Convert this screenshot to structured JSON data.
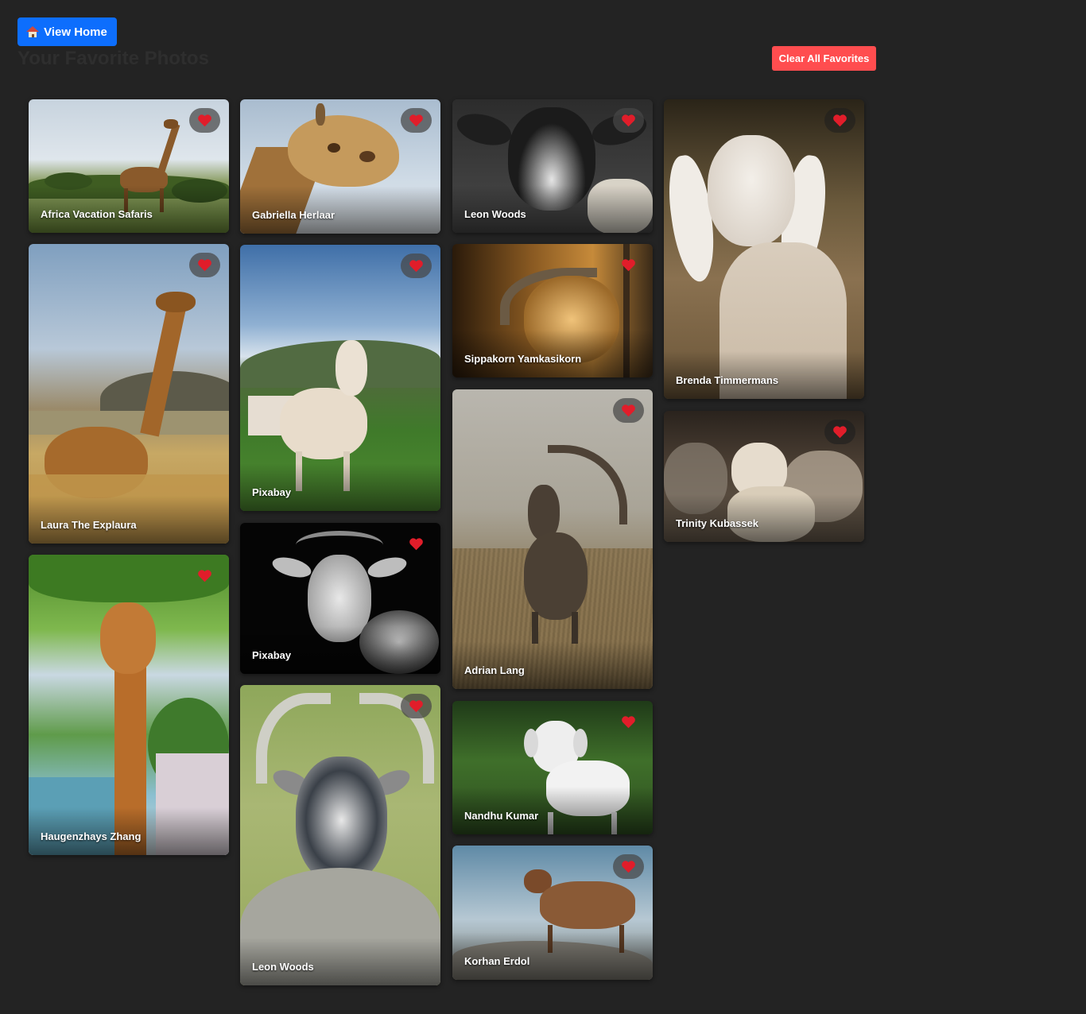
{
  "header": {
    "home_button_label": "View Home",
    "title": "Your Favorite Photos",
    "clear_button_label": "Clear All Favorites"
  },
  "colors": {
    "background": "#232323",
    "primary": "#0d6efd",
    "danger": "#ff4d4f",
    "heart": "#e11d2a"
  },
  "icons": {
    "home": "house-icon",
    "favorite": "heart-icon"
  },
  "gallery": {
    "photos": [
      {
        "credit": "Africa Vacation Safaris",
        "subject": "giraffe",
        "favorited": true
      },
      {
        "credit": "Laura The Explaura",
        "subject": "giraffe",
        "favorited": true
      },
      {
        "credit": "Haugenzhays Zhang",
        "subject": "giraffe",
        "favorited": true
      },
      {
        "credit": "Gabriella Herlaar",
        "subject": "giraffe",
        "favorited": true
      },
      {
        "credit": "Pixabay",
        "subject": "goat",
        "favorited": true
      },
      {
        "credit": "Pixabay",
        "subject": "goat",
        "favorited": true
      },
      {
        "credit": "Leon Woods",
        "subject": "goat",
        "favorited": true
      },
      {
        "credit": "Leon Woods",
        "subject": "sheep",
        "favorited": true
      },
      {
        "credit": "Sippakorn Yamkasikorn",
        "subject": "goat",
        "favorited": true
      },
      {
        "credit": "Adrian Lang",
        "subject": "ibex",
        "favorited": true
      },
      {
        "credit": "Nandhu Kumar",
        "subject": "goat",
        "favorited": true
      },
      {
        "credit": "Korhan Erdol",
        "subject": "goat",
        "favorited": true
      },
      {
        "credit": "Brenda Timmermans",
        "subject": "goat",
        "favorited": true
      },
      {
        "credit": "Trinity Kubassek",
        "subject": "sheep",
        "favorited": true
      }
    ]
  }
}
